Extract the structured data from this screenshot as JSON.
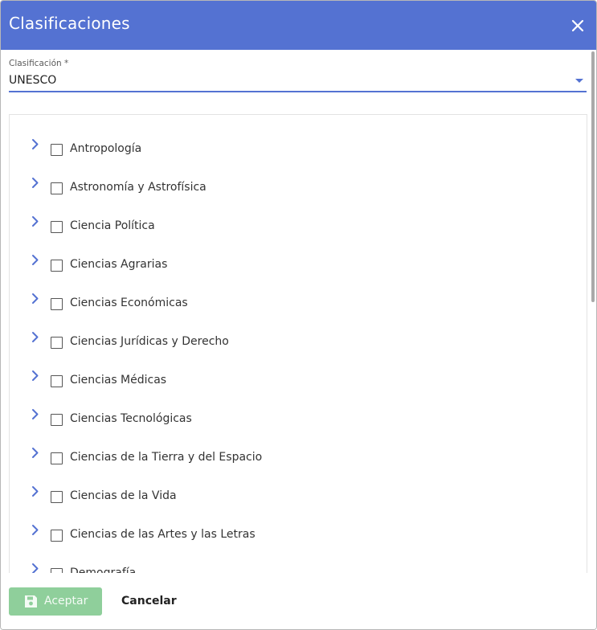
{
  "dialog": {
    "title": "Clasificaciones"
  },
  "field": {
    "label": "Clasificación *",
    "value": "UNESCO"
  },
  "tree": {
    "items": [
      {
        "label": "Antropología"
      },
      {
        "label": "Astronomía y Astrofísica"
      },
      {
        "label": "Ciencia Política"
      },
      {
        "label": "Ciencias Agrarias"
      },
      {
        "label": "Ciencias Económicas"
      },
      {
        "label": "Ciencias Jurídicas y Derecho"
      },
      {
        "label": "Ciencias Médicas"
      },
      {
        "label": "Ciencias Tecnológicas"
      },
      {
        "label": "Ciencias de la Tierra y del Espacio"
      },
      {
        "label": "Ciencias de la Vida"
      },
      {
        "label": "Ciencias de las Artes y las Letras"
      },
      {
        "label": "Demografía"
      }
    ]
  },
  "footer": {
    "accept_label": "Aceptar",
    "cancel_label": "Cancelar"
  },
  "colors": {
    "header": "#5472d2",
    "accent": "#5472d2",
    "accept_disabled": "#8fcf9b"
  },
  "icons": {
    "close": "close-icon",
    "dropdown": "chevron-down-icon",
    "expand": "chevron-right-icon",
    "save": "save-icon"
  }
}
